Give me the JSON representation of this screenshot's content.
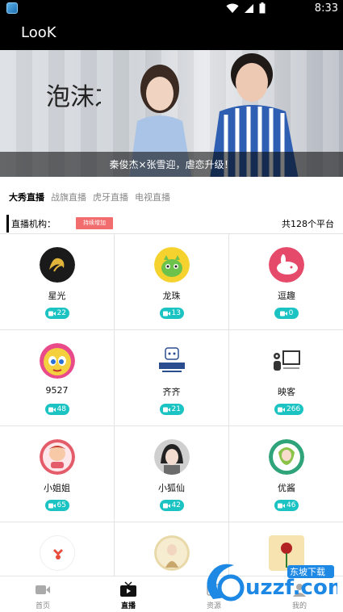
{
  "status_bar": {
    "time": "8:33"
  },
  "app": {
    "title": "LooK"
  },
  "banner": {
    "calligraphy": "泡沫之夏",
    "caption": "秦俊杰×张雪迎，虐恋升级！"
  },
  "tabs": [
    {
      "label": "大秀直播",
      "active": true
    },
    {
      "label": "战旗直播",
      "active": false
    },
    {
      "label": "虎牙直播",
      "active": false
    },
    {
      "label": "电视直播",
      "active": false
    }
  ],
  "org_bar": {
    "label": "直播机构：",
    "badge": "持续增加",
    "count": "共128个平台"
  },
  "platforms": [
    {
      "name": "星光",
      "count": "22",
      "color": "#1a1a1a"
    },
    {
      "name": "龙珠",
      "count": "13",
      "color": "#f5d22e"
    },
    {
      "name": "逗趣",
      "count": "0",
      "color": "#e64a6a"
    },
    {
      "name": "9527",
      "count": "48",
      "color": "#f4d03f"
    },
    {
      "name": "齐齐",
      "count": "21",
      "color": "#ffffff"
    },
    {
      "name": "映客",
      "count": "266",
      "color": "#ffffff"
    },
    {
      "name": "小姐姐",
      "count": "65",
      "color": "#e45c6a"
    },
    {
      "name": "小狐仙",
      "count": "42",
      "color": "#cfcfcf"
    },
    {
      "name": "优酱",
      "count": "46",
      "color": "#2fa37a"
    },
    {
      "name": "",
      "count": "",
      "color": "#ffffff"
    },
    {
      "name": "",
      "count": "",
      "color": "#e9d9a8"
    },
    {
      "name": "",
      "count": "",
      "color": "#f7e3b0"
    }
  ],
  "bottom_nav": [
    {
      "label": "首页",
      "icon": "video-camera-icon",
      "active": false
    },
    {
      "label": "直播",
      "icon": "tv-play-icon",
      "active": true
    },
    {
      "label": "资源",
      "icon": "resource-icon",
      "active": false
    },
    {
      "label": "我的",
      "icon": "profile-icon",
      "active": false
    }
  ],
  "watermark": {
    "brand": "uzzf.com",
    "tag": "东坡下载"
  },
  "colors": {
    "accent": "#1cc3c3",
    "badge": "#f26d6d",
    "topbar": "#000000"
  }
}
